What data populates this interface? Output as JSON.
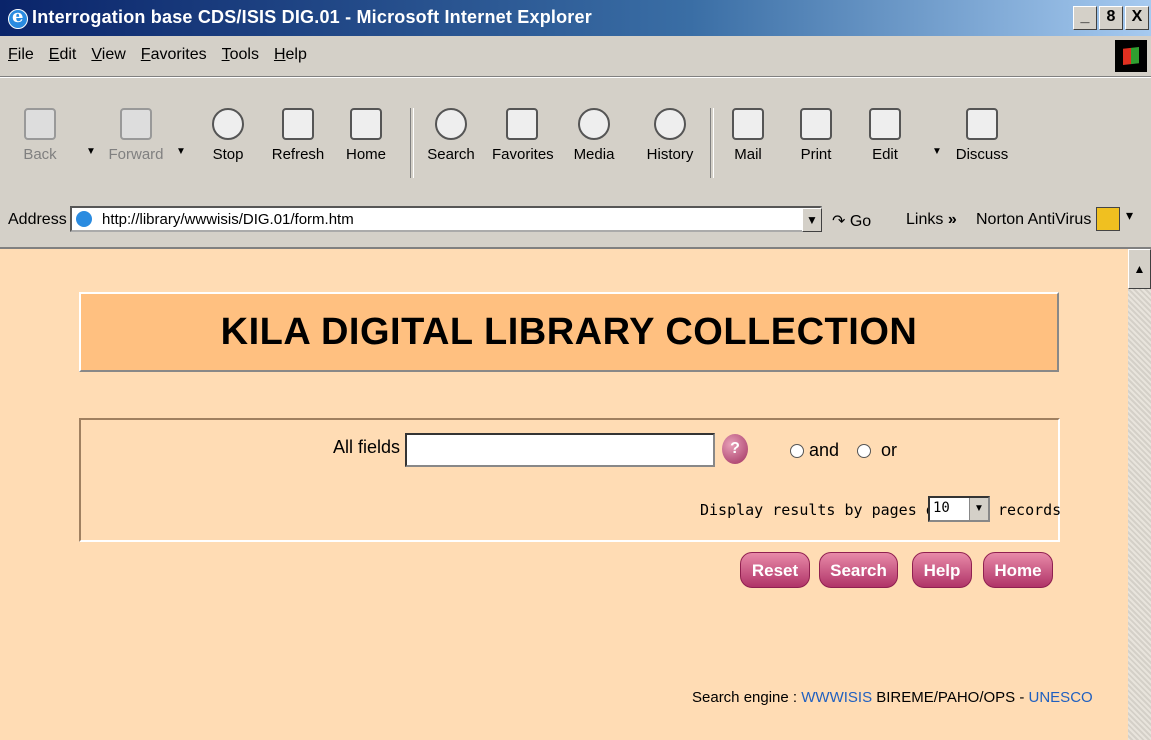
{
  "window": {
    "title": "Interrogation base CDS/ISIS DIG.01 - Microsoft Internet Explorer",
    "buttons": [
      "_",
      "8",
      "X"
    ]
  },
  "menu": [
    "File",
    "Edit",
    "View",
    "Favorites",
    "Tools",
    "Help"
  ],
  "toolbar": {
    "back": "Back",
    "forward": "Forward",
    "stop": "Stop",
    "refresh": "Refresh",
    "home": "Home",
    "search": "Search",
    "favorites": "Favorites",
    "media": "Media",
    "history": "History",
    "mail": "Mail",
    "print": "Print",
    "edit": "Edit",
    "discuss": "Discuss"
  },
  "address": {
    "label": "Address",
    "url": "http://library/wwwisis/DIG.01/form.htm",
    "go": "Go",
    "links": "Links",
    "links_chevron": "»",
    "norton": "Norton AntiVirus"
  },
  "page": {
    "banner": "KILA DIGITAL LIBRARY COLLECTION",
    "all_fields_label": "All fields",
    "all_fields_value": "",
    "help_icon": "?",
    "radio_and": "and",
    "radio_or": "or",
    "display_text": "Display results by pages of",
    "page_size": "10",
    "records_text": "records",
    "buttons": {
      "reset": "Reset",
      "search": "Search",
      "help": "Help",
      "home": "Home"
    },
    "footer": {
      "prefix": "Search engine :",
      "wwwisis": "WWWISIS",
      "middle": "BIREME/PAHO/OPS -",
      "unesco": "UNESCO"
    }
  }
}
